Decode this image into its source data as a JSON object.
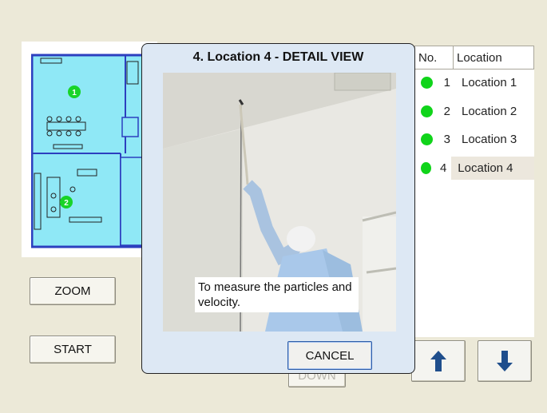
{
  "dialog": {
    "title": "4. Location 4 - DETAIL VIEW",
    "caption": "To measure the particles and velocity.",
    "cancel_label": "CANCEL"
  },
  "buttons": {
    "zoom_label": "ZOOM",
    "start_label": "START",
    "down_label": "DOWN",
    "up_arrow_icon": "arrow-up-icon",
    "down_arrow_icon": "arrow-down-icon"
  },
  "location_list": {
    "header_no": "No.",
    "header_location": "Location",
    "selected_index": 3,
    "items": [
      {
        "no": "1",
        "label": "Location 1",
        "status_color": "#10d41a"
      },
      {
        "no": "2",
        "label": "Location 2",
        "status_color": "#10d41a"
      },
      {
        "no": "3",
        "label": "Location 3",
        "status_color": "#10d41a"
      },
      {
        "no": "4",
        "label": "Location 4",
        "status_color": "#10d41a"
      }
    ]
  },
  "floorplan": {
    "markers": [
      "1",
      "2"
    ],
    "room_color": "#8fe8f6",
    "wall_color": "#2c3fbf",
    "marker_color": "#18d428"
  }
}
